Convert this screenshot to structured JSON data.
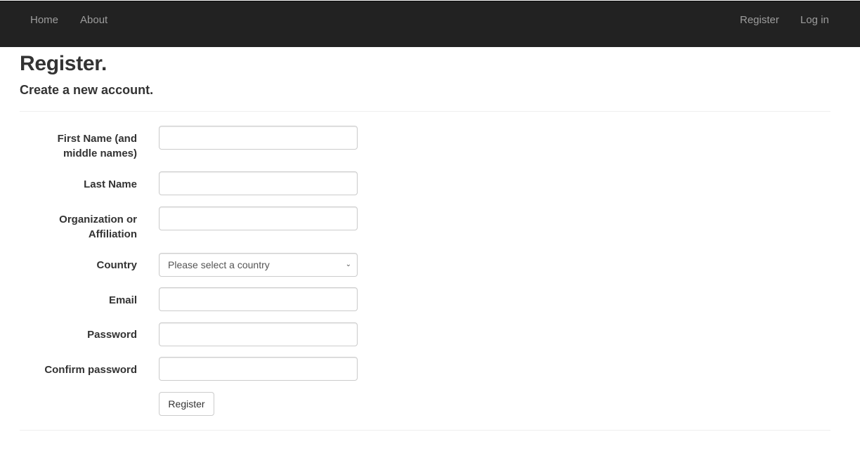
{
  "navbar": {
    "left_links": [
      "Home",
      "About"
    ],
    "right_links": [
      "Register",
      "Log in"
    ]
  },
  "page": {
    "title": "Register.",
    "subtitle": "Create a new account."
  },
  "form": {
    "fields": [
      {
        "label_line1": "First Name (and",
        "label_line2": "middle names)",
        "value": ""
      },
      {
        "label_line1": "Last Name",
        "value": ""
      },
      {
        "label_line1": "Organization or",
        "label_line2": "Affiliation",
        "value": ""
      },
      {
        "label_line1": "Country",
        "selected": "Please select a country"
      },
      {
        "label_line1": "Email",
        "value": ""
      },
      {
        "label_line1": "Password",
        "value": ""
      },
      {
        "label_line1": "Confirm password",
        "value": ""
      }
    ],
    "submit_label": "Register"
  },
  "icons": {
    "select_chevron": "chevron-down-icon"
  }
}
